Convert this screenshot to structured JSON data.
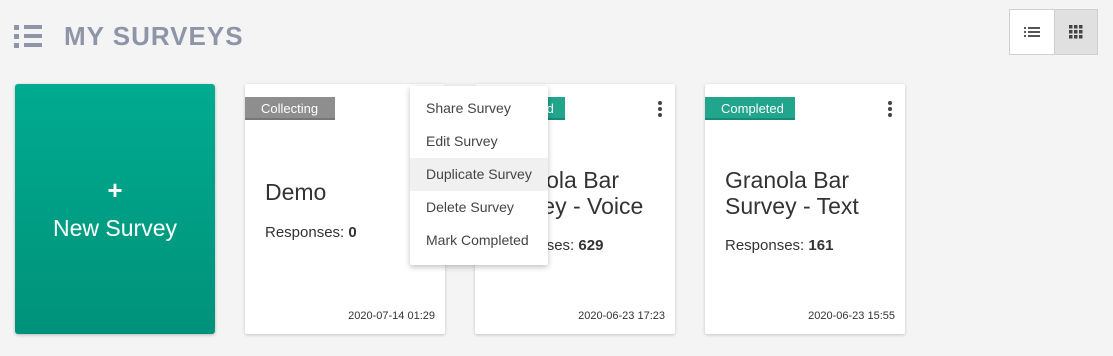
{
  "header": {
    "title": "MY SURVEYS"
  },
  "new_card": {
    "plus": "+",
    "label": "New Survey"
  },
  "cards": [
    {
      "status": "Collecting",
      "title": "Demo",
      "responses_label": "Responses:",
      "responses": "0",
      "date": "2020-07-14 01:29"
    },
    {
      "status": "Completed",
      "title_line1": "Granola Bar",
      "title_line2": "Survey - Voice",
      "responses_label": "Responses:",
      "responses": "629",
      "date": "2020-06-23 17:23"
    },
    {
      "status": "Completed",
      "title_line1": "Granola Bar",
      "title_line2": "Survey - Text",
      "responses_label": "Responses:",
      "responses": "161",
      "date": "2020-06-23 15:55"
    }
  ],
  "menu": {
    "items": [
      "Share Survey",
      "Edit Survey",
      "Duplicate Survey",
      "Delete Survey",
      "Mark Completed"
    ],
    "hovered": "Duplicate Survey"
  },
  "colors": {
    "accent": "#00ab8f",
    "completed": "#22a58d",
    "collecting": "#8e8e8e",
    "title": "#8f95a8"
  }
}
